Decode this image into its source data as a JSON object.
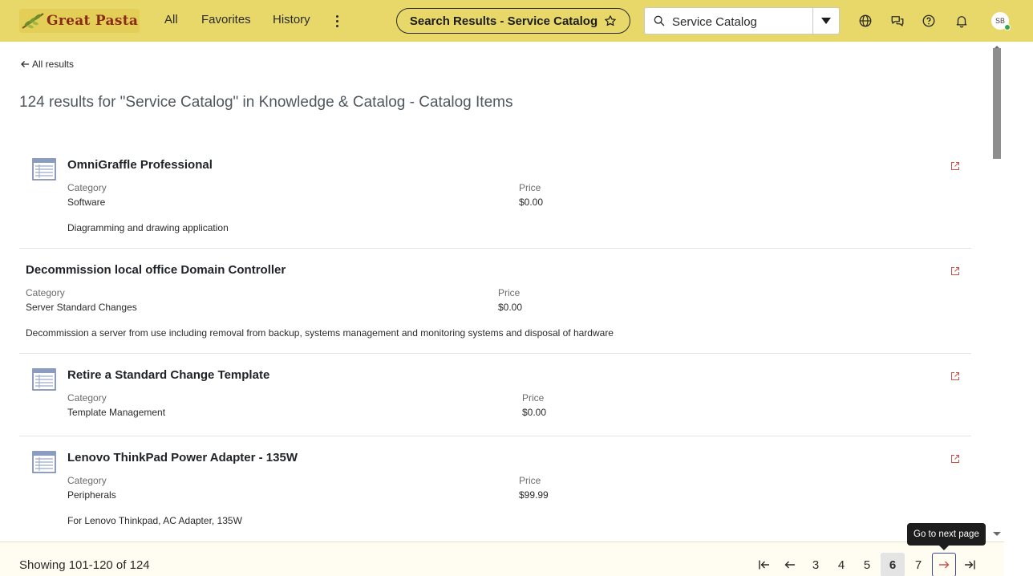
{
  "header": {
    "logo_text": "Great Pasta",
    "nav": {
      "all": "All",
      "favorites": "Favorites",
      "history": "History"
    },
    "context_pill": "Search Results - Service Catalog",
    "search": {
      "value": "Service Catalog"
    },
    "avatar_initials": "SB",
    "colors": {
      "bar": "#e8d86a",
      "logo_text": "#8a2b1a"
    }
  },
  "page": {
    "back_label": "All results",
    "results_heading": "124 results for \"Service Catalog\" in Knowledge & Catalog - Catalog Items"
  },
  "results": [
    {
      "title": "OmniGraffle Professional",
      "category_label": "Category",
      "category": "Software",
      "price_label": "Price",
      "price": "$0.00",
      "description": "Diagramming and drawing application",
      "has_icon": true
    },
    {
      "title": "Decommission local office Domain Controller",
      "category_label": "Category",
      "category": "Server Standard Changes",
      "price_label": "Price",
      "price": "$0.00",
      "description": "Decommission a server from use including removal from backup, systems management and monitoring systems and disposal of hardware",
      "has_icon": false
    },
    {
      "title": "Retire a Standard Change Template",
      "category_label": "Category",
      "category": "Template Management",
      "price_label": "Price",
      "price": "$0.00",
      "description": "",
      "has_icon": true
    },
    {
      "title": "Lenovo ThinkPad Power Adapter - 135W",
      "category_label": "Category",
      "category": "Peripherals",
      "price_label": "Price",
      "price": "$99.99",
      "description": "For Lenovo Thinkpad, AC Adapter, 135W",
      "has_icon": true
    }
  ],
  "footer": {
    "showing": "Showing 101-120 of 124",
    "pages": [
      "3",
      "4",
      "5",
      "6",
      "7"
    ],
    "current_page": "6",
    "tooltip": "Go to next page"
  }
}
